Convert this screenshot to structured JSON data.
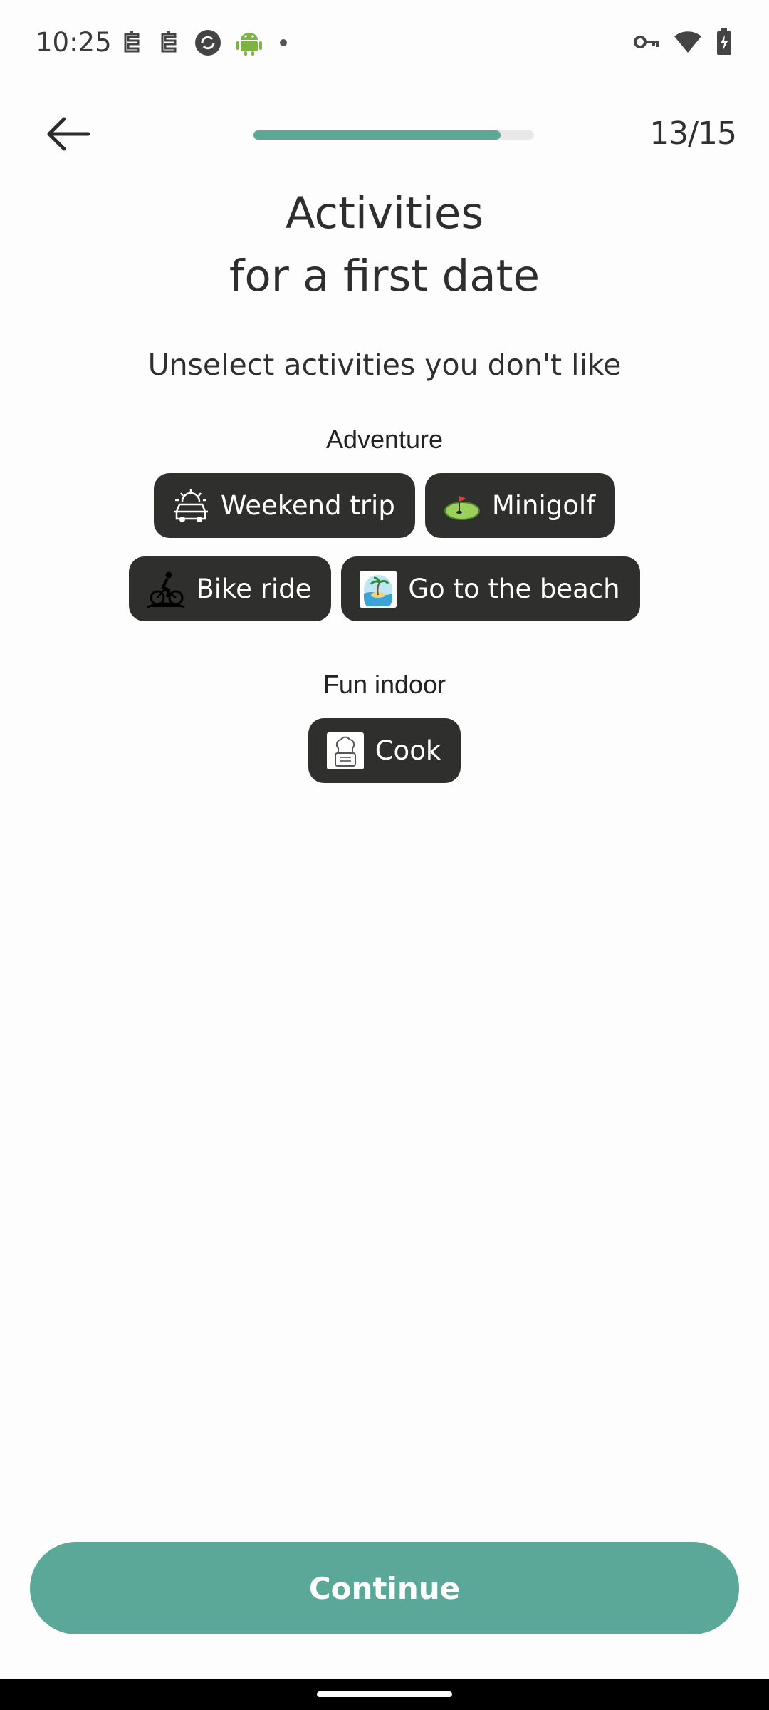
{
  "status": {
    "time": "10:25",
    "left_icons": [
      "notification-icon",
      "notification-icon",
      "sync-icon",
      "android-icon",
      "dot-icon"
    ],
    "right_icons": [
      "vpn-key-icon",
      "wifi-icon",
      "battery-charging-icon"
    ]
  },
  "header": {
    "back_label": "Back",
    "progress": 0.88,
    "step": "13/15"
  },
  "title": {
    "line1": "Activities",
    "line2": "for a first date"
  },
  "subtitle": "Unselect activities you don't like",
  "groups": [
    {
      "title": "Adventure",
      "activities": [
        {
          "label": "Weekend trip",
          "icon": "car-sunrise-icon"
        },
        {
          "label": "Minigolf",
          "icon": "minigolf-icon"
        },
        {
          "label": "Bike ride",
          "icon": "bike-icon"
        },
        {
          "label": "Go to the beach",
          "icon": "beach-icon"
        }
      ]
    },
    {
      "title": "Fun indoor",
      "activities": [
        {
          "label": "Cook",
          "icon": "chef-hat-icon"
        }
      ]
    }
  ],
  "continue_label": "Continue",
  "colors": {
    "accent": "#5ba899",
    "chip_bg": "#2f2f2e",
    "background": "#fdfdfd"
  }
}
